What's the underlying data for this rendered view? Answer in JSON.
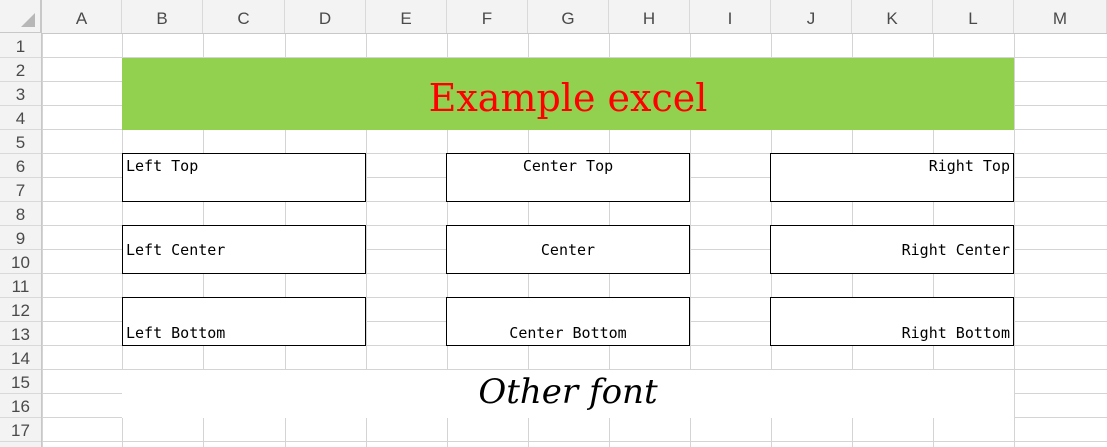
{
  "columns": [
    "A",
    "B",
    "C",
    "D",
    "E",
    "F",
    "G",
    "H",
    "I",
    "J",
    "K",
    "L",
    "M"
  ],
  "rows": [
    "1",
    "2",
    "3",
    "4",
    "5",
    "6",
    "7",
    "8",
    "9",
    "10",
    "11",
    "12",
    "13",
    "14",
    "15",
    "16",
    "17"
  ],
  "banner": {
    "text": "Example excel",
    "fill": "#92d050",
    "font_color": "#ff0000"
  },
  "cells": {
    "left_top": "Left Top",
    "center_top": "Center Top",
    "right_top": "Right Top",
    "left_center": "Left Center",
    "center": "Center",
    "right_center": "Right Center",
    "left_bottom": "Left Bottom",
    "center_bottom": "Center Bottom",
    "right_bottom": "Right Bottom"
  },
  "other_font": "Other font"
}
